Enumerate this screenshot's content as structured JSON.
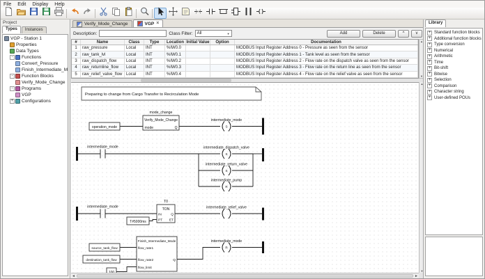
{
  "menu": {
    "items": [
      "File",
      "Edit",
      "Display",
      "Help"
    ]
  },
  "toolbar": {
    "groups": [
      [
        "new-file",
        "open-project",
        "save",
        "save-as",
        "print"
      ],
      [
        "undo",
        "redo"
      ],
      [
        "cut",
        "copy",
        "paste"
      ],
      [
        "search"
      ],
      [
        "select-tool",
        "motion-tool",
        "comment-tool",
        "connection-tool",
        "contact-tool",
        "branch-tool",
        "block-tool",
        "power-rail-tool",
        "coil-tool"
      ]
    ],
    "active_tool": "select-tool"
  },
  "icons": {
    "close": "×",
    "dropdown_arrow": "▼",
    "scroll_up": "▲",
    "scroll_down": "▼",
    "scroll_left": "◄",
    "scroll_right": "►",
    "expander_collapsed": "+",
    "expander_expanded": "-"
  },
  "colors": {
    "selection_highlight": "#cfe3f7",
    "wire": "#1a1a1a",
    "folder_accent": "#f0a030"
  },
  "project_panel": {
    "title": "Project",
    "tabs": [
      {
        "label": "Types",
        "active": true
      },
      {
        "label": "Instances",
        "active": false
      }
    ],
    "tree": [
      {
        "label": "VGP - Station 1",
        "depth": 0,
        "icon": "project",
        "expander": null
      },
      {
        "label": "Properties",
        "depth": 1,
        "icon": "properties",
        "expander": null
      },
      {
        "label": "Data Types",
        "depth": 1,
        "icon": "datatypes",
        "expander": null
      },
      {
        "label": "Functions",
        "depth": 1,
        "icon": "functions",
        "expander": "expanded"
      },
      {
        "label": "Convert_Pressure",
        "depth": 2,
        "icon": "function",
        "expander": null
      },
      {
        "label": "Finish_Intermediate_Mode",
        "depth": 2,
        "icon": "function",
        "expander": null
      },
      {
        "label": "Function Blocks",
        "depth": 1,
        "icon": "functionblocks",
        "expander": "expanded"
      },
      {
        "label": "Verify_Mode_Change",
        "depth": 2,
        "icon": "functionblock",
        "expander": null
      },
      {
        "label": "Programs",
        "depth": 1,
        "icon": "programs",
        "expander": "expanded"
      },
      {
        "label": "VGP",
        "depth": 2,
        "icon": "program",
        "expander": null
      },
      {
        "label": "Configurations",
        "depth": 1,
        "icon": "configurations",
        "expander": "collapsed"
      }
    ]
  },
  "editor": {
    "tabs": [
      {
        "label": "Verify_Mode_Change",
        "active": false
      },
      {
        "label": "VGP",
        "active": true
      }
    ],
    "description_label": "Description:",
    "description_value": "",
    "class_filter_label": "Class Filter:",
    "class_filter_value": "All",
    "buttons": {
      "add": "Add",
      "delete": "Delete",
      "up": "^",
      "down": "v"
    },
    "variables_table": {
      "columns": [
        "#",
        "Name",
        "Class",
        "Type",
        "Location",
        "Initial Value",
        "Option",
        "Documentation"
      ],
      "rows": [
        [
          "1",
          "raw_pressure",
          "Local",
          "INT",
          "%IW0.0",
          "",
          "",
          "MODBUS Input Register Address 0 - Pressure as seen from the sensor"
        ],
        [
          "2",
          "raw_tank_lvl",
          "Local",
          "INT",
          "%IW0.1",
          "",
          "",
          "MODBUS Input Register Address 1 - Tank level as seen from the sensor"
        ],
        [
          "3",
          "raw_dispatch_flow",
          "Local",
          "INT",
          "%IW0.2",
          "",
          "",
          "MODBUS Input Register Address 2 - Flow rate on the dispatch valve as seen from the sensor"
        ],
        [
          "4",
          "raw_returnline_flow",
          "Local",
          "INT",
          "%IW0.3",
          "",
          "",
          "MODBUS Input Register Address 3 - Flow rate on the return line as seen from the sensor"
        ],
        [
          "5",
          "raw_relief_valve_flow",
          "Local",
          "INT",
          "%IW0.4",
          "",
          "",
          "MODBUS Input Register Address 4 - Flow rate on the relief valve as seen from the sensor"
        ]
      ]
    },
    "ladder": {
      "comment": "Preparing to change from Cargo Transfer to Recirculation Mode",
      "rung1": {
        "input_var": "operation_mode",
        "block_instance": "mode_change",
        "block_type": "Verify_Mode_Change",
        "block_input": "mode",
        "block_output": "Q",
        "coil": "intermediate_mode",
        "coil_mode": "S"
      },
      "rung2": {
        "contact": "intermediate_mode",
        "coils": [
          {
            "label": "intermediate_dispatch_valve",
            "mode": "S"
          },
          {
            "label": "intermediate_return_valve",
            "mode": "S"
          },
          {
            "label": "intermediate_pump",
            "mode": "R"
          }
        ]
      },
      "rung3": {
        "contact": "intermediate_mode",
        "timer_instance": "T0",
        "timer_type": "TON",
        "timer_in1": "IN",
        "timer_in2": "PT",
        "timer_out1": "Q",
        "timer_out2": "ET",
        "preset_value": "T#5000ms",
        "coil": "intermediate_relief_valve",
        "coil_mode": ""
      },
      "rung4": {
        "input_vars": [
          "source_tank_flow",
          "destination_tank_flow",
          "100"
        ],
        "block_type": "Finish_Intermediate_Mode",
        "block_inputs": [
          "flow_rate1",
          "flow_rate2",
          "flow_limit"
        ],
        "block_output": "Q",
        "coil": "intermediate_mode",
        "coil_mode": "R"
      }
    }
  },
  "library_panel": {
    "title": "Library",
    "items": [
      "Standard function blocks",
      "Additional function blocks",
      "Type conversion",
      "Numerical",
      "Arithmetic",
      "Time",
      "Bit-shift",
      "Bitwise",
      "Selection",
      "Comparison",
      "Character string",
      "User-defined POUs"
    ]
  }
}
